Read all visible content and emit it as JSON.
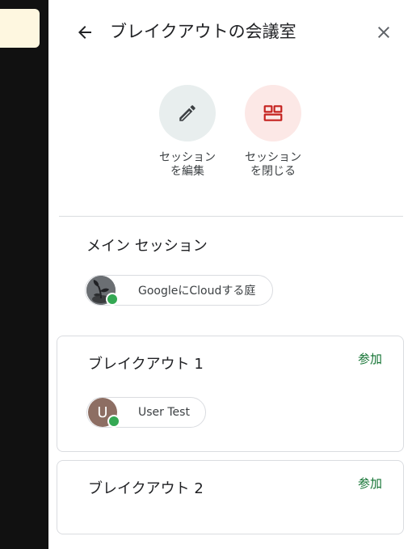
{
  "header": {
    "title": "ブレイクアウトの会議室",
    "back_icon": "arrow-left-icon",
    "close_icon": "close-icon"
  },
  "actions": [
    {
      "label": "セッションを編集",
      "icon": "pencil-icon",
      "bg": "#e8eeee",
      "color": "#3c4043"
    },
    {
      "label": "セッションを閉じる",
      "icon": "grid-layout-icon",
      "bg": "#fce8e6",
      "color": "#c5221f"
    }
  ],
  "main_session": {
    "title": "メイン セッション",
    "participants": [
      {
        "name": "GoogleにCloudする庭",
        "avatar": "plant-photo",
        "status": "online"
      }
    ]
  },
  "rooms": [
    {
      "title": "ブレイクアウト 1",
      "join_label": "参加",
      "participants": [
        {
          "name": "User Test",
          "initial": "U",
          "avatar_color": "#8d6e63",
          "status": "online"
        }
      ]
    },
    {
      "title": "ブレイクアウト 2",
      "join_label": "参加",
      "participants": []
    }
  ],
  "colors": {
    "accent_green": "#137333",
    "status_online": "#34a853",
    "close_red": "#c5221f"
  }
}
